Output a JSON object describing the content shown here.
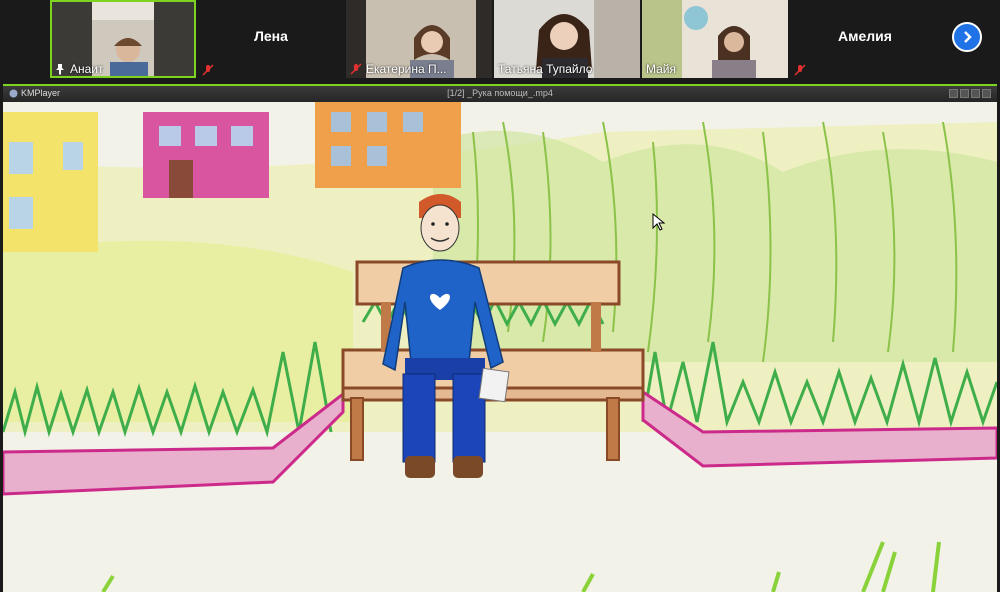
{
  "participants": [
    {
      "name": "Анаит",
      "pinned": true,
      "muted": false,
      "active": true
    },
    {
      "name": "Лена",
      "muted": true,
      "video": false
    },
    {
      "name": "Екатерина П...",
      "muted": true
    },
    {
      "name": "Татьяна Тупайло",
      "muted": false
    },
    {
      "name": "Майя",
      "muted": false
    },
    {
      "name": "Амелия",
      "muted": true,
      "video": false
    }
  ],
  "icons": {
    "pin": "pin-icon",
    "mute": "mic-muted-icon",
    "next": "chevron-right-icon"
  },
  "player": {
    "app_name": "KMPlayer",
    "file_title": "[1/2] _Рука помощи_.mp4"
  },
  "colors": {
    "active_speaker": "#7ed321",
    "next_button": "#1f73e6",
    "muted_icon": "#e03030"
  }
}
